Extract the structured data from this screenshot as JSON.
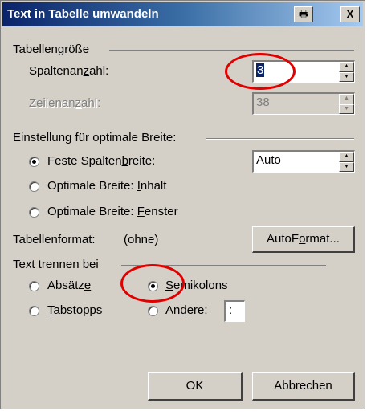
{
  "window": {
    "title": "Text in Tabelle umwandeln",
    "help_icon": "help-icon",
    "close_label": "X"
  },
  "table_size": {
    "legend": "Tabellengröße",
    "columns_label_pre": "Spaltenan",
    "columns_label_u": "z",
    "columns_label_post": "ahl:",
    "columns_value": "3",
    "rows_label_pre": "Zeilenan",
    "rows_label_u": "z",
    "rows_label_post": "ahl:",
    "rows_value": "38"
  },
  "width_settings": {
    "legend": "Einstellung für optimale Breite:",
    "fixed_pre": "Feste Spalten",
    "fixed_u": "b",
    "fixed_post": "reite:",
    "fixed_value": "Auto",
    "content_pre": "Optimale Breite: ",
    "content_u": "I",
    "content_post": "nhalt",
    "window_pre": "Optimale Breite: ",
    "window_u": "F",
    "window_post": "enster",
    "selected": "fixed"
  },
  "table_format": {
    "label": "Tabellenformat:",
    "value": "(ohne)",
    "button_pre": "AutoF",
    "button_u": "o",
    "button_post": "rmat..."
  },
  "separator": {
    "legend": "Text trennen bei",
    "paragraphs_pre": "Absätz",
    "paragraphs_u": "e",
    "paragraphs_post": "",
    "semicolons_pre": "",
    "semicolons_u": "S",
    "semicolons_post": "emikolons",
    "tabs_pre": "",
    "tabs_u": "T",
    "tabs_post": "abstopps",
    "other_pre": "An",
    "other_u": "d",
    "other_post": "ere:",
    "other_value": ":",
    "selected": "semicolons"
  },
  "buttons": {
    "ok": "OK",
    "cancel": "Abbrechen"
  },
  "annotation_color": "#e00000"
}
